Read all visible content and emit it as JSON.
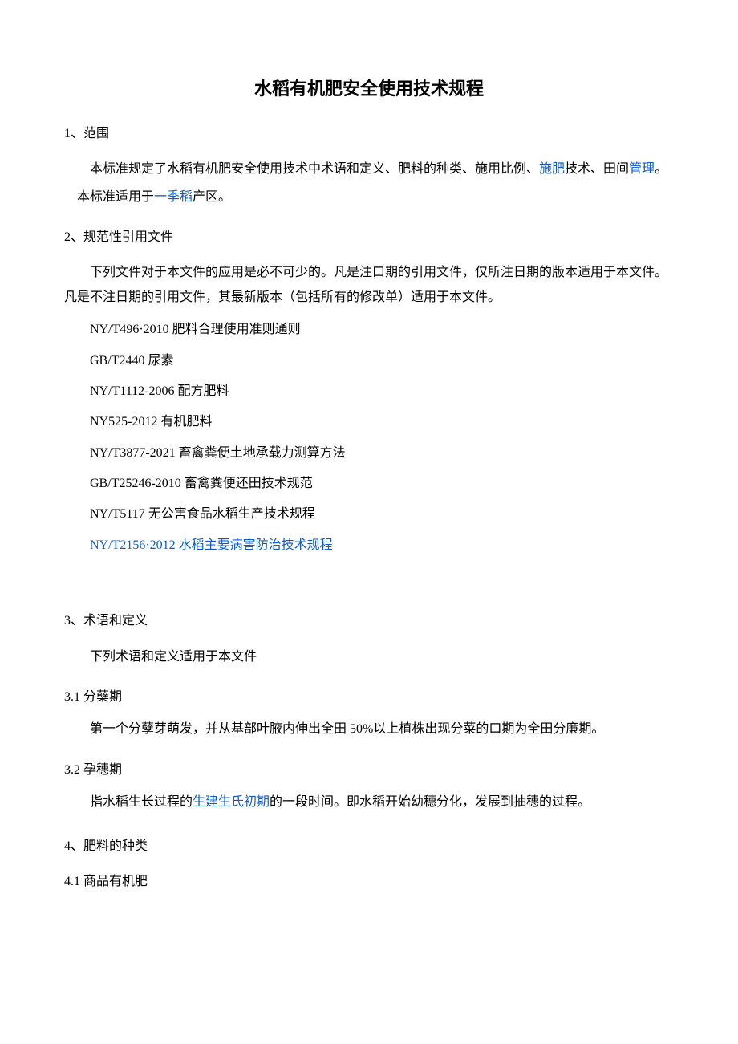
{
  "title": "水稻有机肥安全使用技术规程",
  "s1": {
    "heading": "1、范围",
    "p1_a": "本标准规定了水稻有机肥安全使用技术中术语和定义、肥料的种类、施用比例、",
    "p1_link1": "施肥",
    "p1_b": "技术、田间",
    "p1_link2": "管理",
    "p1_c": "。",
    "p2_a": "本标准适用于",
    "p2_link": "一季稻",
    "p2_b": "产区。"
  },
  "s2": {
    "heading": "2、规范性引用文件",
    "p1": "下列文件对于本文件的应用是必不可少的。凡是注口期的引用文件，仅所注日期的版本适用于本文件。凡是不注日期的引用文件，其最新版本（包括所有的修改单）适用于本文件。",
    "refs": [
      "NY/T496·2010 肥料合理使用准则通则",
      "GB/T2440 尿素",
      "NY/T1112-2006 配方肥料",
      "NY525-2012 有机肥料",
      "NY/T3877-2021 畜禽粪便土地承载力测算方法",
      "GB/T25246-2010 畜禽粪便还田技术规范",
      "NY/T5117 无公害食品水稻生产技术规程"
    ],
    "ref_link": "NY/T2156·2012 水稻主要病害防治技术规程"
  },
  "s3": {
    "heading": "3、术语和定义",
    "p1": "下列术语和定义适用于本文件",
    "s31_heading": "3.1    分蘖期",
    "s31_p": "第一个分孽芽萌发，并从基部叶腋内伸出全田 50%以上植株出现分菜的口期为全田分廉期。",
    "s32_heading": "3.2    孕穗期",
    "s32_a": "指水稻生长过程的",
    "s32_link": "生建生氏初期",
    "s32_b": "的一段时间。即水稻开始幼穗分化，发展到抽穗的过程。"
  },
  "s4": {
    "heading": "4、肥料的种类",
    "s41_heading": "4.1    商品有机肥"
  }
}
